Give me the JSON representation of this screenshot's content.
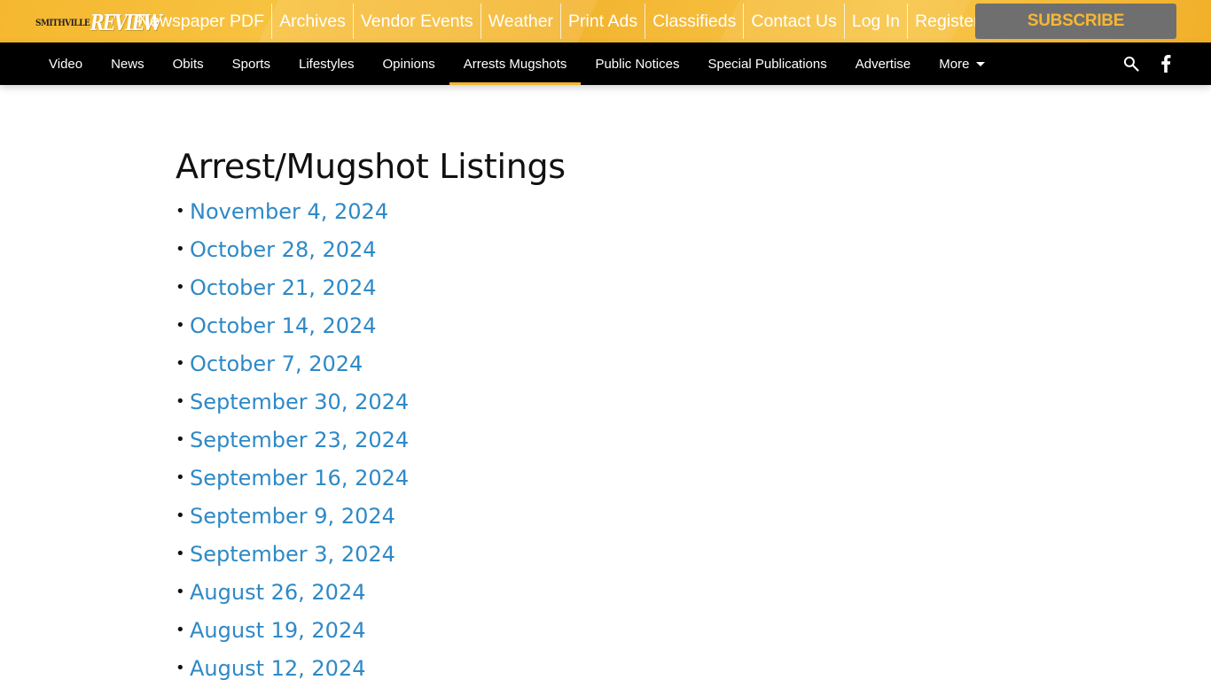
{
  "logo": {
    "small": "SMITHVILLE",
    "big": "REVIEW"
  },
  "topnav": [
    "Newspaper PDF",
    "Archives",
    "Vendor Events",
    "Weather",
    "Print Ads",
    "Classifieds",
    "Contact Us",
    "Log In",
    "Register"
  ],
  "subscribe_label": "SUBSCRIBE",
  "mainnav": [
    "Video",
    "News",
    "Obits",
    "Sports",
    "Lifestyles",
    "Opinions",
    "Arrests Mugshots",
    "Public Notices",
    "Special Publications",
    "Advertise"
  ],
  "mainnav_active": "Arrests Mugshots",
  "more_label": "More",
  "icons": {
    "search": "search-icon",
    "facebook": "facebook-icon"
  },
  "colors": {
    "accent": "#f3b530",
    "link": "#2e89c6",
    "nav_bg": "#000000",
    "subscribe_bg": "#6f6f6f"
  },
  "page_title": "Arrest/Mugshot Listings",
  "bullet": "•",
  "listings": [
    "November 4, 2024",
    "October 28, 2024",
    "October 21, 2024",
    "October 14, 2024",
    "October 7, 2024",
    "September 30, 2024",
    "September 23, 2024",
    "September 16, 2024",
    "September 9, 2024",
    "September 3, 2024",
    "August 26, 2024",
    "August 19, 2024",
    "August 12, 2024"
  ]
}
